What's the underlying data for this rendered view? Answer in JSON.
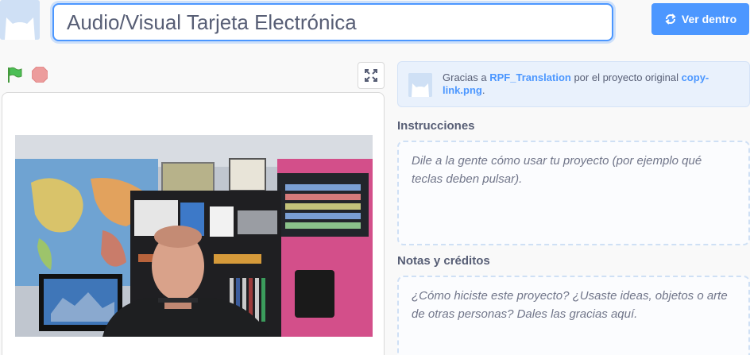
{
  "header": {
    "project_title": "Audio/Visual Tarjeta Electrónica",
    "see_inside_label": "Ver dentro"
  },
  "icons": {
    "project_avatar": "cat-avatar-icon",
    "see_inside": "remix-arrows-icon",
    "green_flag": "green-flag-icon",
    "stop": "stop-sign-icon",
    "fullscreen": "fullscreen-icon"
  },
  "colors": {
    "accent": "#4c97ff",
    "flag": "#4cbf56",
    "stop": "#ec9c9c"
  },
  "credit": {
    "prefix": "Gracias a ",
    "author": "RPF_Translation",
    "middle": " por el proyecto original ",
    "original_project": "copy-link.png",
    "suffix": "."
  },
  "instructions": {
    "title": "Instrucciones",
    "placeholder": "Dile a la gente cómo usar tu proyecto (por ejemplo qué teclas deben pulsar)."
  },
  "notes": {
    "title": "Notas y créditos",
    "placeholder": "¿Cómo hiciste este proyecto? ¿Usaste ideas, objetos o arte de otras personas? Dales las gracias aquí."
  }
}
